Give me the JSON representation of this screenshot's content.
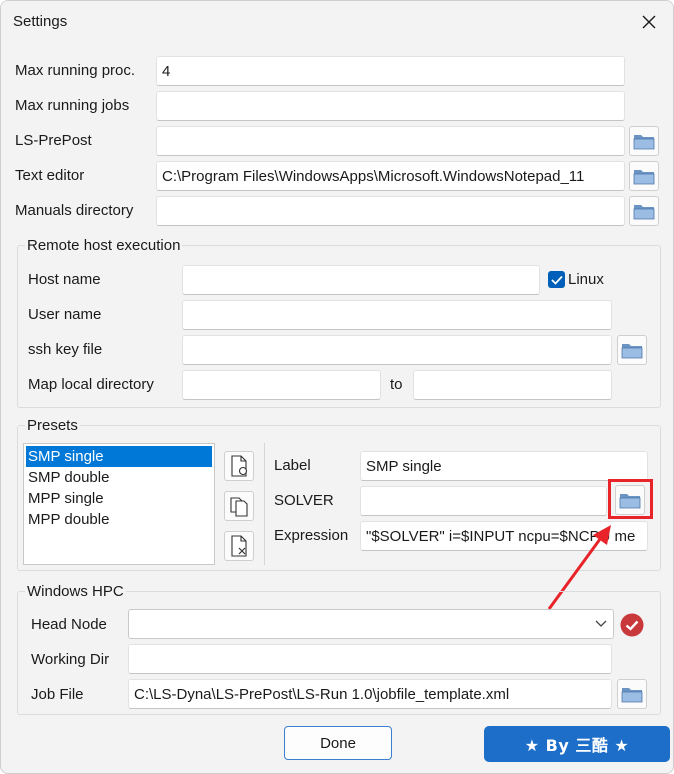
{
  "window": {
    "title": "Settings"
  },
  "general": {
    "max_proc_label": "Max running proc.",
    "max_proc_value": "4",
    "max_jobs_label": "Max running jobs",
    "max_jobs_value": "",
    "lsprepost_label": "LS-PrePost",
    "lsprepost_value": "",
    "text_editor_label": "Text editor",
    "text_editor_value": "C:\\Program Files\\WindowsApps\\Microsoft.WindowsNotepad_11",
    "manuals_label": "Manuals directory",
    "manuals_value": ""
  },
  "remote": {
    "group_title": "Remote host execution",
    "host_label": "Host name",
    "host_value": "",
    "linux_label": "Linux",
    "linux_checked": true,
    "user_label": "User name",
    "user_value": "",
    "ssh_label": "ssh key file",
    "ssh_value": "",
    "map_label": "Map local directory",
    "map_local_value": "",
    "to_label": "to",
    "map_remote_value": ""
  },
  "presets": {
    "group_title": "Presets",
    "items": [
      "SMP single",
      "SMP double",
      "MPP single",
      "MPP double"
    ],
    "selected": "SMP single",
    "label_label": "Label",
    "label_value": "SMP single",
    "solver_label": "SOLVER",
    "solver_value": "",
    "expression_label": "Expression",
    "expression_value": "\"$SOLVER\" i=$INPUT ncpu=$NCPU me"
  },
  "hpc": {
    "group_title": "Windows HPC",
    "head_label": "Head Node",
    "head_value": "",
    "working_label": "Working Dir",
    "working_value": "",
    "jobfile_label": "Job File",
    "jobfile_value": "C:\\LS-Dyna\\LS-PrePost\\LS-Run 1.0\\jobfile_template.xml"
  },
  "footer": {
    "done_label": "Done",
    "badge_text": "★ By 三酷 ★"
  },
  "colors": {
    "accent": "#0078d7",
    "highlight": "#e8232a",
    "status_red": "#c9383a",
    "badge_bg": "#1c6ec8"
  }
}
